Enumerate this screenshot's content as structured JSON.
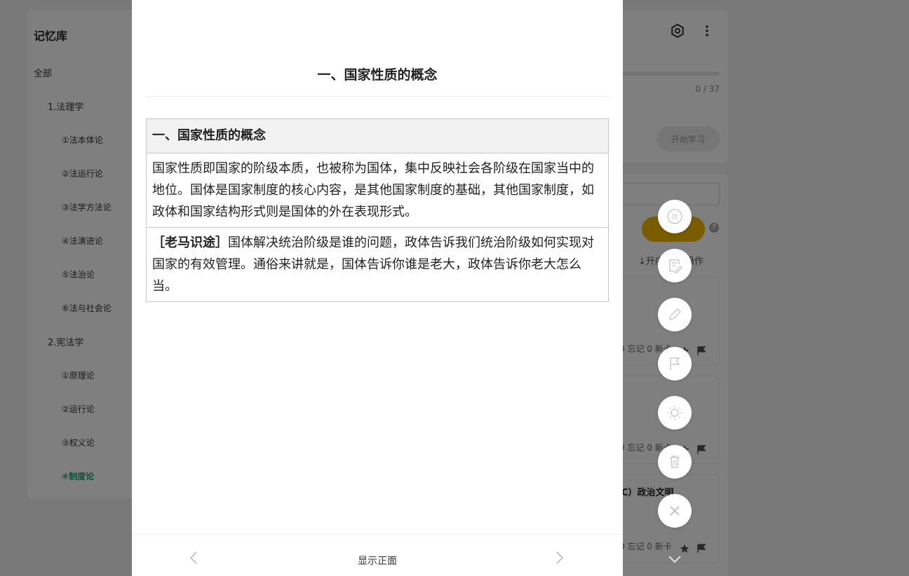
{
  "sidebar": {
    "title": "记忆库",
    "items": [
      {
        "label": "全部",
        "level": 0
      },
      {
        "label": "1.法理学",
        "level": 1
      },
      {
        "label": "①法本体论",
        "level": 2
      },
      {
        "label": "②法运行论",
        "level": 2
      },
      {
        "label": "③法学方法论",
        "level": 2
      },
      {
        "label": "④法演进论",
        "level": 2
      },
      {
        "label": "⑤法治论",
        "level": 2
      },
      {
        "label": "⑥法与社会论",
        "level": 2
      },
      {
        "label": "2.宪法学",
        "level": 1
      },
      {
        "label": "①原理论",
        "level": 2
      },
      {
        "label": "②运行论",
        "level": 2
      },
      {
        "label": "③权义论",
        "level": 2
      },
      {
        "label": "④制度论",
        "level": 2,
        "active": true
      }
    ]
  },
  "study_panel": {
    "progress_text": "0 / 37",
    "progress_value": 0,
    "start_label": "开始学习"
  },
  "card_list": {
    "sort_text": "↓升序  批量操作",
    "cards": [
      {
        "title": "",
        "stats": "0 忘记 0 新卡"
      },
      {
        "title": "",
        "stats": "0 忘记 0 新卡"
      },
      {
        "title": "C）政治文明",
        "stats": "0 忘记 0 新卡"
      }
    ]
  },
  "modal": {
    "heading": "一、国家性质的概念",
    "table": {
      "head": "一、国家性质的概念",
      "para1": "国家性质即国家的阶级本质，也被称为国体，集中反映社会各阶级在国家当中的地位。国体是国家制度的核心内容，是其他国家制度的基础，其他国家制度，如政体和国家结构形式则是国体的外在表现形式。",
      "para2_bold": "［老马识途］",
      "para2": "国体解决统治阶级是谁的问题，政体告诉我们统治阶级如何实现对国家的有效管理。通俗来讲就是，国体告诉你谁是老大，政体告诉你老大怎么当。"
    },
    "footer": {
      "show_front_label": "显示正面"
    }
  },
  "colors": {
    "accent_green": "#1aa37a",
    "accent_yellow": "#f5b800",
    "overlay": "rgba(0,0,0,0.5)"
  },
  "fab_icons": [
    "pause-icon",
    "edit-note-icon",
    "pencil-icon",
    "flag-icon",
    "sun-icon",
    "trash-icon",
    "close-icon"
  ]
}
